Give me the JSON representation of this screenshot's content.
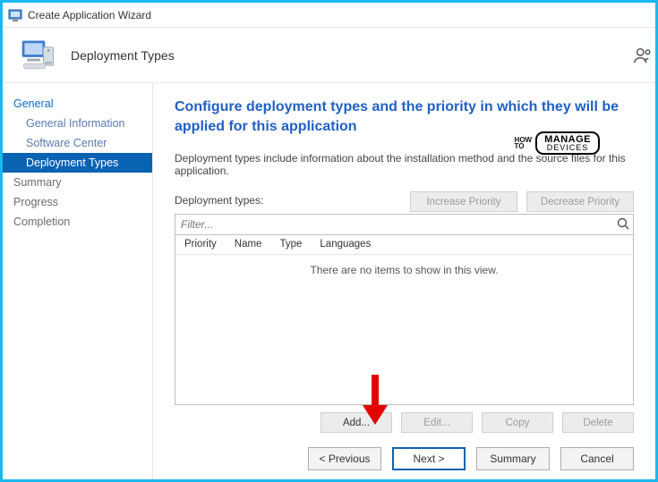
{
  "title": "Create Application Wizard",
  "header": {
    "page_name": "Deployment Types"
  },
  "sidebar": {
    "items": [
      {
        "label": "General",
        "kind": "top"
      },
      {
        "label": "General Information",
        "kind": "sub"
      },
      {
        "label": "Software Center",
        "kind": "sub"
      },
      {
        "label": "Deployment Types",
        "kind": "selected"
      },
      {
        "label": "Summary",
        "kind": "dim"
      },
      {
        "label": "Progress",
        "kind": "dim"
      },
      {
        "label": "Completion",
        "kind": "dim"
      }
    ]
  },
  "main": {
    "heading": "Configure deployment types and the priority in which they will be applied for this application",
    "description": "Deployment types include information about the installation method and the source files for this application.",
    "list_label": "Deployment types:",
    "increase_label": "Increase Priority",
    "decrease_label": "Decrease Priority",
    "filter_placeholder": "Filter...",
    "columns": {
      "c1": "Priority",
      "c2": "Name",
      "c3": "Type",
      "c4": "Languages"
    },
    "empty_text": "There are no items to show in this view.",
    "actions": {
      "add": "Add...",
      "edit": "Edit...",
      "copy": "Copy",
      "delete": "Delete"
    }
  },
  "footer": {
    "previous": "< Previous",
    "next": "Next >",
    "summary": "Summary",
    "cancel": "Cancel"
  },
  "watermark": {
    "line1": "HOW",
    "line2": "TO",
    "brand_top": "MANAGE",
    "brand_bottom": "DEVICES"
  }
}
